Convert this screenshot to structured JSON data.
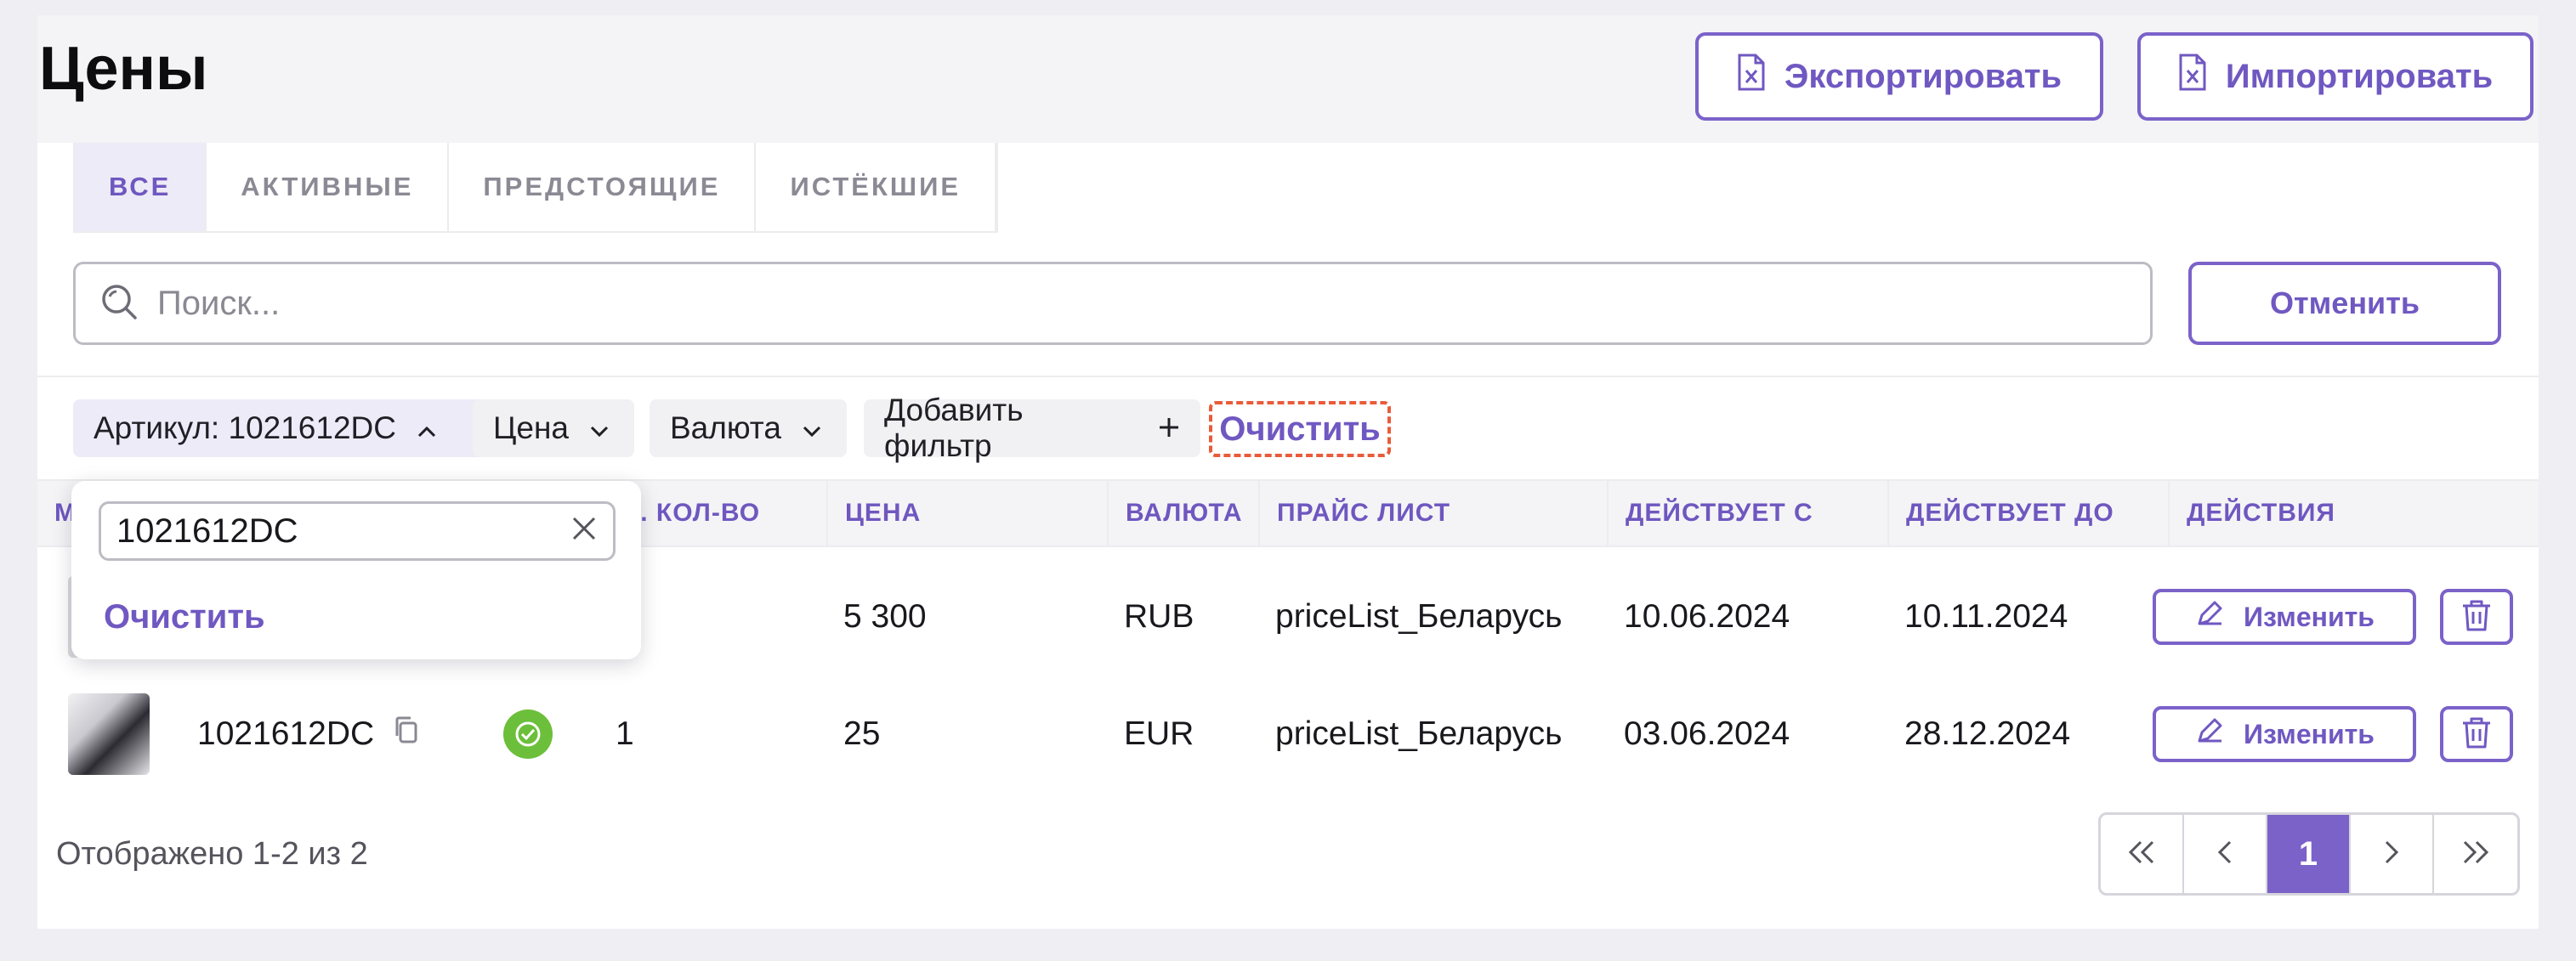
{
  "page": {
    "title": "Цены"
  },
  "toolbar": {
    "export_label": "Экспортировать",
    "import_label": "Импортировать"
  },
  "tabs": [
    {
      "label": "ВСЕ",
      "active": true
    },
    {
      "label": "АКТИВНЫЕ",
      "active": false
    },
    {
      "label": "ПРЕДСТОЯЩИЕ",
      "active": false
    },
    {
      "label": "ИСТЁКШИЕ",
      "active": false
    }
  ],
  "search": {
    "placeholder": "Поиск...",
    "cancel_label": "Отменить"
  },
  "filters": {
    "chips": [
      {
        "label": "Артикул: 1021612DC",
        "icon": "chevron-up-icon",
        "active": true
      },
      {
        "label": "Цена",
        "icon": "chevron-down-icon",
        "active": false
      },
      {
        "label": "Валюта",
        "icon": "chevron-down-icon",
        "active": false
      },
      {
        "label": "Добавить фильтр",
        "icon": "plus-icon",
        "active": false
      }
    ],
    "clear_label": "Очистить"
  },
  "popover": {
    "value": "1021612DC",
    "clear_label": "Очистить"
  },
  "table": {
    "columns": [
      {
        "key": "media",
        "label": "М"
      },
      {
        "key": "article",
        "label": ""
      },
      {
        "key": "status",
        "label": ""
      },
      {
        "key": "min_qty",
        "label": "ИН. КОЛ-ВО"
      },
      {
        "key": "price",
        "label": "ЦЕНА"
      },
      {
        "key": "currency",
        "label": "ВАЛЮТА"
      },
      {
        "key": "price_list",
        "label": "ПРАЙС ЛИСТ"
      },
      {
        "key": "valid_from",
        "label": "ДЕЙСТВУЕТ С"
      },
      {
        "key": "valid_to",
        "label": "ДЕЙСТВУЕТ ДО"
      },
      {
        "key": "actions",
        "label": "ДЕЙСТВИЯ"
      }
    ],
    "rows": [
      {
        "article": "",
        "min_qty": "",
        "price": "5 300",
        "currency": "RUB",
        "price_list": "priceList_Беларусь",
        "valid_from": "10.06.2024",
        "valid_to": "10.11.2024",
        "edit_label": "Изменить",
        "status": ""
      },
      {
        "article": "1021612DC",
        "min_qty": "1",
        "price": "25",
        "currency": "EUR",
        "price_list": "priceList_Беларусь",
        "valid_from": "03.06.2024",
        "valid_to": "28.12.2024",
        "edit_label": "Изменить",
        "status": "ok"
      }
    ]
  },
  "pagination": {
    "summary": "Отображено 1-2 из 2",
    "current_page": "1",
    "icons": [
      "double-chevron-left-icon",
      "chevron-left-icon",
      "chevron-right-icon",
      "double-chevron-right-icon"
    ]
  },
  "colors": {
    "accent": "#7b62c9",
    "highlight_dashed": "#e95b3a",
    "status_ok": "#6cbf3a"
  }
}
